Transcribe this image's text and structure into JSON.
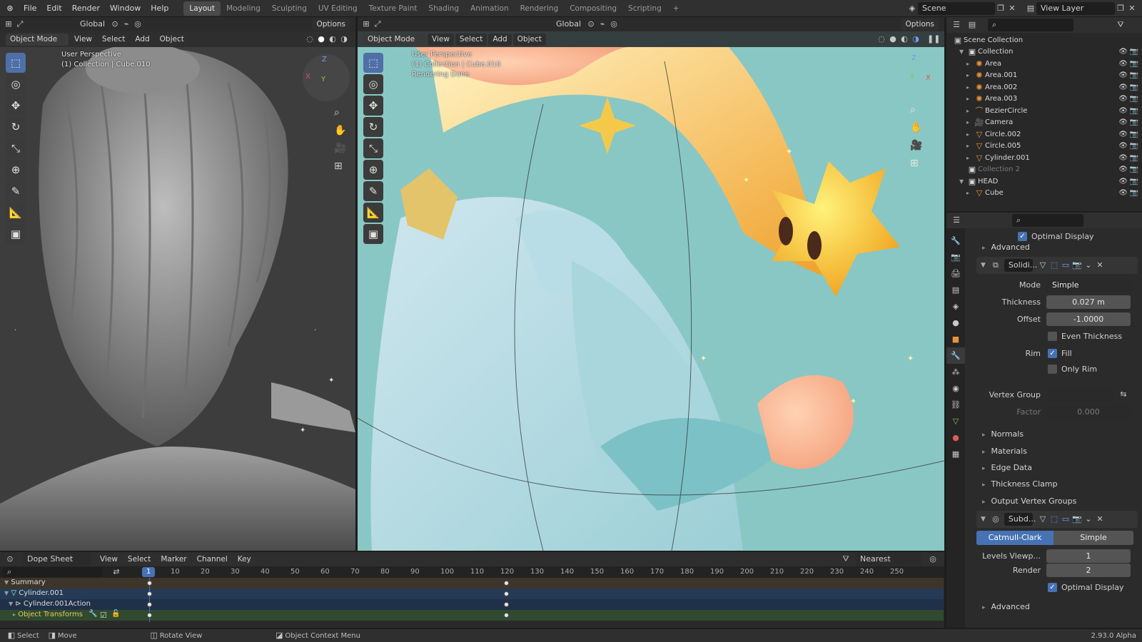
{
  "topbar": {
    "menus": [
      "File",
      "Edit",
      "Render",
      "Window",
      "Help"
    ],
    "workspaces": [
      "Layout",
      "Modeling",
      "Sculpting",
      "UV Editing",
      "Texture Paint",
      "Shading",
      "Animation",
      "Rendering",
      "Compositing",
      "Scripting"
    ],
    "active_workspace": "Layout",
    "add_tab": "+",
    "scene": "Scene",
    "view_layer": "View Layer"
  },
  "left_viewport": {
    "mode": "Object Mode",
    "menus": [
      "View",
      "Select",
      "Add",
      "Object"
    ],
    "orientation": "Global",
    "options": "Options",
    "info_line1": "User Perspective",
    "info_line2": "(1) Collection | Cube.010"
  },
  "right_viewport": {
    "mode": "Object Mode",
    "menus": [
      "View",
      "Select",
      "Add",
      "Object"
    ],
    "orientation": "Global",
    "options": "Options",
    "info_line1": "User Perspective",
    "info_line2": "(1) Collection | Cube.010",
    "info_line3": "Rendering Done"
  },
  "outliner": {
    "root": "Scene Collection",
    "items": [
      {
        "label": "Collection",
        "indent": 1,
        "expanded": true,
        "icon": "collection-icon",
        "dim": false
      },
      {
        "label": "Area",
        "indent": 2,
        "icon": "light-icon",
        "dim": false
      },
      {
        "label": "Area.001",
        "indent": 2,
        "icon": "light-icon",
        "dim": false
      },
      {
        "label": "Area.002",
        "indent": 2,
        "icon": "light-icon",
        "dim": false
      },
      {
        "label": "Area.003",
        "indent": 2,
        "icon": "light-icon",
        "dim": false
      },
      {
        "label": "BezierCircle",
        "indent": 2,
        "icon": "curve-icon",
        "dim": false
      },
      {
        "label": "Camera",
        "indent": 2,
        "icon": "camera-icon",
        "dim": false
      },
      {
        "label": "Circle.002",
        "indent": 2,
        "icon": "mesh-icon",
        "dim": false
      },
      {
        "label": "Circle.005",
        "indent": 2,
        "icon": "mesh-icon",
        "dim": false
      },
      {
        "label": "Cylinder.001",
        "indent": 2,
        "icon": "mesh-icon",
        "dim": false
      },
      {
        "label": "Collection 2",
        "indent": 1,
        "icon": "collection-icon",
        "dim": true
      },
      {
        "label": "HEAD",
        "indent": 1,
        "expanded": true,
        "icon": "collection-icon",
        "dim": false
      },
      {
        "label": "Cube",
        "indent": 2,
        "icon": "mesh-icon",
        "dim": false
      }
    ]
  },
  "properties": {
    "top_optimal_display": "Optimal Display",
    "top_advanced": "Advanced",
    "solidify": {
      "name": "Solidi...",
      "mode_label": "Mode",
      "mode_value": "Simple",
      "thickness_label": "Thickness",
      "thickness_value": "0.027 m",
      "offset_label": "Offset",
      "offset_value": "-1.0000",
      "even_thickness": "Even Thickness",
      "rim_label": "Rim",
      "fill": "Fill",
      "only_rim": "Only Rim",
      "vertex_group_label": "Vertex Group",
      "factor_label": "Factor",
      "factor_value": "0.000",
      "sections": [
        "Normals",
        "Materials",
        "Edge Data",
        "Thickness Clamp",
        "Output Vertex Groups"
      ]
    },
    "subdivision": {
      "name": "Subd...",
      "catmull": "Catmull-Clark",
      "simple": "Simple",
      "levels_label": "Levels Viewp...",
      "levels_value": "1",
      "render_label": "Render",
      "render_value": "2",
      "optimal_display": "Optimal Display",
      "advanced": "Advanced"
    }
  },
  "dopesheet": {
    "editor": "Dope Sheet",
    "menus": [
      "View",
      "Select",
      "Marker",
      "Channel",
      "Key"
    ],
    "snap": "Nearest Frame",
    "current_frame": "1",
    "frame_ticks": [
      "10",
      "20",
      "30",
      "40",
      "50",
      "60",
      "70",
      "80",
      "90",
      "100",
      "110",
      "120",
      "130",
      "140",
      "150",
      "160",
      "170",
      "180",
      "190",
      "200",
      "210",
      "220",
      "230",
      "240",
      "250"
    ],
    "channels": [
      "Summary",
      "Cylinder.001",
      "Cylinder.001Action",
      "Object Transforms"
    ],
    "keyframes": [
      1,
      120
    ]
  },
  "statusbar": {
    "select": "Select",
    "move": "Move",
    "rotate": "Rotate View",
    "context": "Object Context Menu",
    "version": "2.93.0 Alpha"
  }
}
